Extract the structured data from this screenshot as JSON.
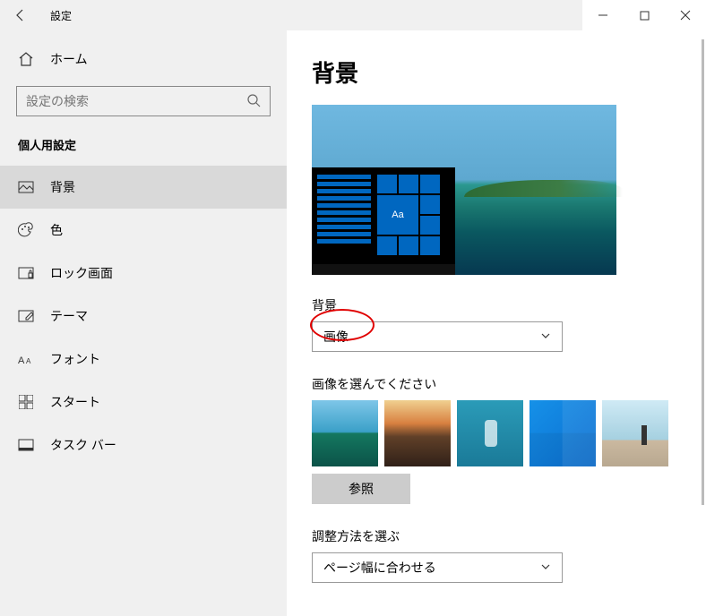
{
  "titlebar": {
    "title": "設定"
  },
  "sidebar": {
    "home": "ホーム",
    "search_placeholder": "設定の検索",
    "category": "個人用設定",
    "items": [
      {
        "label": "背景",
        "icon": "picture"
      },
      {
        "label": "色",
        "icon": "palette"
      },
      {
        "label": "ロック画面",
        "icon": "lock-frame"
      },
      {
        "label": "テーマ",
        "icon": "theme"
      },
      {
        "label": "フォント",
        "icon": "font"
      },
      {
        "label": "スタート",
        "icon": "start"
      },
      {
        "label": "タスク バー",
        "icon": "taskbar"
      }
    ],
    "active_index": 0
  },
  "main": {
    "heading": "背景",
    "preview_sample_text": "Aa",
    "bg_section_label": "背景",
    "bg_dropdown_value": "画像",
    "choose_image_label": "画像を選んでください",
    "browse_label": "参照",
    "fit_label": "調整方法を選ぶ",
    "fit_dropdown_value": "ページ幅に合わせる"
  }
}
